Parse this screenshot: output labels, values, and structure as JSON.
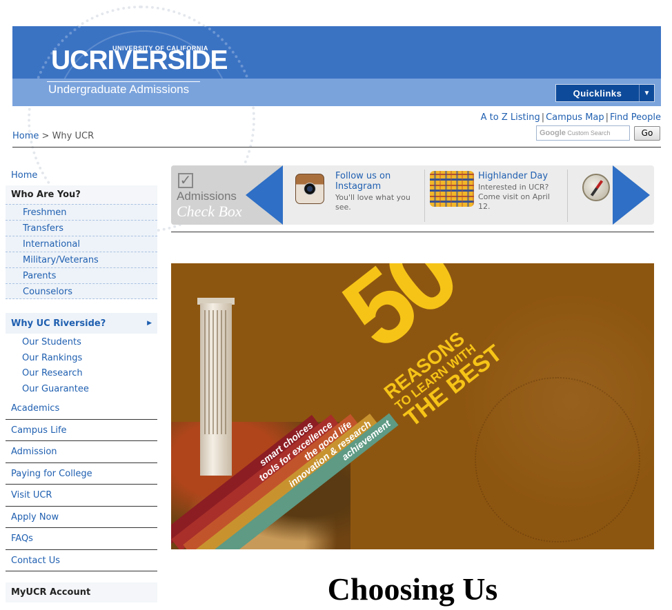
{
  "header": {
    "uc_small": "UNIVERSITY OF CALIFORNIA",
    "logo": "UCRIVERSIDE",
    "subtitle": "Undergraduate Admissions",
    "quicklinks_label": "Quicklinks",
    "quicklinks_arrow": "▼"
  },
  "toplinks": {
    "a_to_z": "A to Z Listing",
    "campus_map": "Campus Map",
    "find_people": "Find People",
    "separator": "|"
  },
  "breadcrumb": {
    "home": "Home",
    "separator": ">",
    "current": "Why UCR"
  },
  "search": {
    "google": "Google",
    "placeholder": "Custom Search",
    "go_label": "Go"
  },
  "sidebar": {
    "home": "Home",
    "who_heading": "Who Are You?",
    "who_items": [
      "Freshmen",
      "Transfers",
      "International",
      "Military/Veterans",
      "Parents",
      "Counselors"
    ],
    "why_heading": "Why UC Riverside?",
    "why_items": [
      "Our Students",
      "Our Rankings",
      "Our Research",
      "Our Guarantee"
    ],
    "main_items": [
      "Academics",
      "Campus Life",
      "Admission",
      "Paying for College",
      "Visit UCR",
      "Apply Now",
      "FAQs",
      "Contact Us"
    ],
    "account_heading": "MyUCR Account"
  },
  "carousel": {
    "checkbox_line1": "Admissions",
    "checkbox_line2": "Check Box",
    "slot1_title": "Follow us on Instagram",
    "slot1_desc": "You'll love what you see.",
    "slot2_title": "Highlander Day",
    "slot2_desc": "Interested in UCR? Come visit on April 12."
  },
  "hero": {
    "number": "50",
    "reasons": "REASONS",
    "to_learn": "TO LEARN WITH",
    "the_best": "THE BEST",
    "stripes": [
      "smart choices",
      "tools for excellence",
      "the good life",
      "innovation & research",
      "achievement"
    ],
    "stripe_colors": [
      "#8c1d23",
      "#a82f2a",
      "#c2542b",
      "#c8932f",
      "#5e9a84"
    ]
  },
  "page_title": "Choosing Us"
}
